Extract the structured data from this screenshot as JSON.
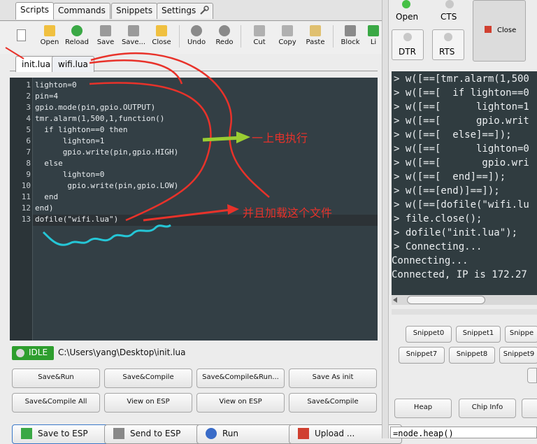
{
  "tabs": [
    "Scripts",
    "Commands",
    "Snippets",
    "Settings"
  ],
  "toolbar": [
    "Open",
    "Reload",
    "Save",
    "Save...",
    "Close",
    "Undo",
    "Redo",
    "Cut",
    "Copy",
    "Paste",
    "Block",
    "Li"
  ],
  "file_tabs": [
    "init.lua",
    "wifi.lua"
  ],
  "code_lines": [
    "lighton=0",
    "pin=4",
    "gpio.mode(pin,gpio.OUTPUT)",
    "tmr.alarm(1,500,1,function()",
    "  if lighton==0 then",
    "      lighton=1",
    "      gpio.write(pin,gpio.HIGH)",
    "  else",
    "      lighton=0",
    "       gpio.write(pin,gpio.LOW)",
    "  end",
    "end)",
    "dofile(\"wifi.lua\")"
  ],
  "line_numbers": [
    "1",
    "2",
    "3",
    "4",
    "5",
    "6",
    "7",
    "8",
    "9",
    "10",
    "11",
    "12",
    "13"
  ],
  "status": {
    "state": "IDLE",
    "path": "C:\\Users\\yang\\Desktop\\init.lua"
  },
  "buttons_row1": [
    "Save&Run",
    "Save&Compile",
    "Save&Compile&Run...",
    "Save As init"
  ],
  "buttons_row2": [
    "Save&Compile All",
    "View on ESP",
    "View on ESP",
    "Save&Compile"
  ],
  "buttons_row3": [
    "Save to ESP",
    "Send to ESP",
    "Run",
    "Upload ..."
  ],
  "right_controls": {
    "open": "Open",
    "cts": "CTS",
    "dtr": "DTR",
    "rts": "RTS",
    "close": "Close"
  },
  "terminal_lines": [
    "> w([==[tmr.alarm(1,500",
    "> w([==[  if lighton==0",
    "> w([==[      lighton=1",
    "> w([==[      gpio.writ",
    "> w([==[  else]==]);",
    "> w([==[      lighton=0",
    "> w([==[       gpio.wri",
    "> w([==[  end]==]);",
    "> w([==[end)]==]);",
    "> w([==[dofile(\"wifi.lu",
    "> file.close();",
    "> dofile(\"init.lua\");",
    "> Connecting...",
    "Connecting...",
    "Connected, IP is 172.27"
  ],
  "snippets_row1": [
    "Snippet0",
    "Snippet1",
    "Snippe"
  ],
  "snippets_row2": [
    "Snippet7",
    "Snippet8",
    "Snippet9"
  ],
  "bottom_buttons": [
    "Heap",
    "Chip Info"
  ],
  "bottom_text": "=node.heap()",
  "annotations": {
    "first": "一上电执行",
    "second": "并且加载这个文件"
  },
  "colors": {
    "editor_bg": "#333f45",
    "terminal_bg": "#303c40",
    "annotation_red": "#e8322a",
    "arrow_green": "#9acd32",
    "wave_cyan": "#25c6d6",
    "idle_green": "#2e9e2e"
  }
}
